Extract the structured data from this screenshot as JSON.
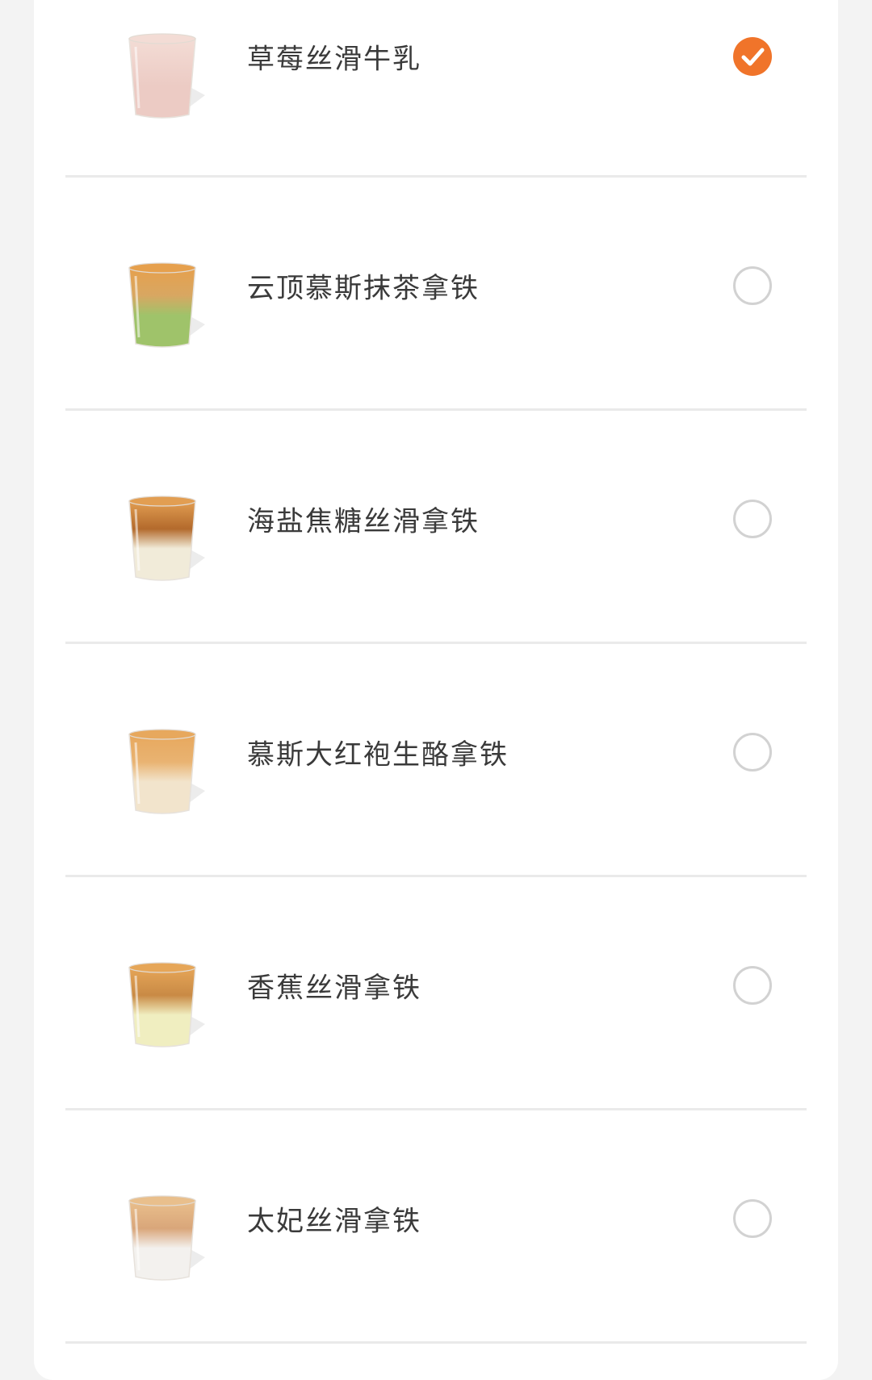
{
  "theme": {
    "accent": "#f0742a",
    "text": "#3a3a3a",
    "divider": "#eaeaea",
    "radio_border": "#d2d2d2",
    "page_bg": "#f3f3f3",
    "card_bg": "#ffffff"
  },
  "drinks": [
    {
      "name": "草莓丝滑牛乳",
      "selected": true,
      "icon": "strawberry-milk-cup-icon",
      "layers": [
        "#f3dcd5",
        "#efd2cb",
        "#eccbc4"
      ]
    },
    {
      "name": "云顶慕斯抹茶拿铁",
      "selected": false,
      "icon": "matcha-latte-cup-icon",
      "layers": [
        "#e6a04d",
        "#d8a762",
        "#9fc36a"
      ]
    },
    {
      "name": "海盐焦糖丝滑拿铁",
      "selected": false,
      "icon": "sea-salt-caramel-latte-cup-icon",
      "layers": [
        "#e29e52",
        "#b36a2c",
        "#f1ebd9"
      ]
    },
    {
      "name": "慕斯大红袍生酪拿铁",
      "selected": false,
      "icon": "da-hong-pao-latte-cup-icon",
      "layers": [
        "#e7a85d",
        "#e9b372",
        "#f2e4cc"
      ]
    },
    {
      "name": "香蕉丝滑拿铁",
      "selected": false,
      "icon": "banana-latte-cup-icon",
      "layers": [
        "#e6a658",
        "#c98a45",
        "#f0eec0"
      ]
    },
    {
      "name": "太妃丝滑拿铁",
      "selected": false,
      "icon": "toffee-latte-cup-icon",
      "layers": [
        "#e9bf8c",
        "#d9a67a",
        "#f3f1ee"
      ]
    }
  ]
}
